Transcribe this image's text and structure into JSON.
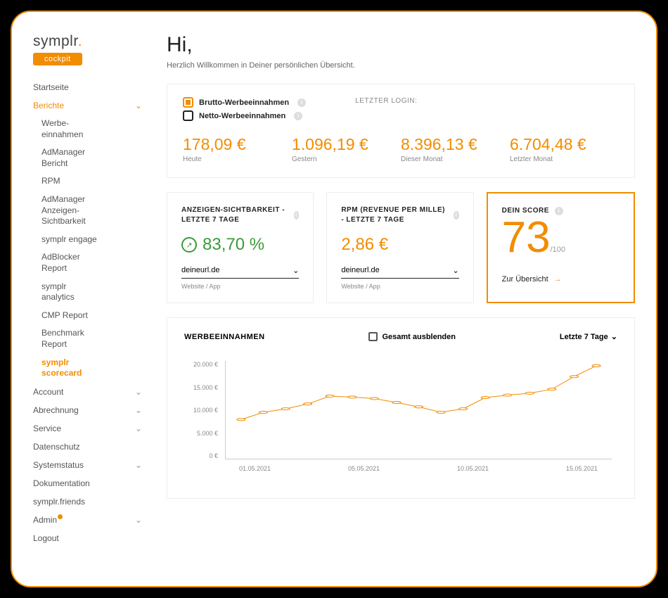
{
  "brand": {
    "name": "symplr",
    "badge": "cockpit"
  },
  "nav": {
    "startseite": "Startseite",
    "berichte": "Berichte",
    "sub": {
      "werbe": "Werbe-\neinnahmen",
      "admanager": "AdManager\nBericht",
      "rpm": "RPM",
      "anzeigen": "AdManager\nAnzeigen-\nSichtbarkeit",
      "engage": "symplr engage",
      "adblocker": "AdBlocker\nReport",
      "analytics": "symplr\nanalytics",
      "cmp": "CMP Report",
      "benchmark": "Benchmark\nReport",
      "scorecard": "symplr\nscorecard"
    },
    "account": "Account",
    "abrechnung": "Abrechnung",
    "service": "Service",
    "datenschutz": "Datenschutz",
    "systemstatus": "Systemstatus",
    "dokumentation": "Dokumentation",
    "friends": "symplr.friends",
    "admin": "Admin",
    "logout": "Logout"
  },
  "header": {
    "greeting": "Hi,",
    "sub": "Herzlich Willkommen in Deiner persönlichen Übersicht."
  },
  "top": {
    "brutto": "Brutto-Werbeeinnahmen",
    "netto": "Netto-Werbeeinnahmen",
    "login": "LETZTER LOGIN:",
    "stats": [
      {
        "val": "178,09 €",
        "lbl": "Heute"
      },
      {
        "val": "1.096,19 €",
        "lbl": "Gestern"
      },
      {
        "val": "8.396,13 €",
        "lbl": "Dieser Monat"
      },
      {
        "val": "6.704,48 €",
        "lbl": "Letzter Monat"
      }
    ]
  },
  "cards": {
    "sicht": {
      "title": "ANZEIGEN-SICHTBARKEIT - LETZTE 7 TAGE",
      "val": "83,70 %",
      "select": "deineurl.de",
      "sub": "Website / App"
    },
    "rpm": {
      "title": "RPM (REVENUE PER MILLE) - LETZTE 7 TAGE",
      "val": "2,86 €",
      "select": "deineurl.de",
      "sub": "Website / App"
    },
    "score": {
      "title": "DEIN SCORE",
      "val": "73",
      "max": "/100",
      "link": "Zur Übersicht"
    }
  },
  "chart": {
    "title": "WERBEEINNAHMEN",
    "toggle": "Gesamt ausblenden",
    "period": "Letzte 7 Tage"
  },
  "chart_data": {
    "type": "line",
    "title": "WERBEEINNAHMEN",
    "ylabel": "€",
    "ylim": [
      0,
      20000
    ],
    "y_ticks": [
      "20.000 €",
      "15.000 €",
      "10.000 €",
      "5.000 €",
      "0 €"
    ],
    "x_ticks": [
      "01.05.2021",
      "05.05.2021",
      "10.05.2021",
      "15.05.2021"
    ],
    "series": [
      {
        "name": "Gesamt",
        "color": "#f28c00",
        "values": [
          8000,
          9500,
          10200,
          11200,
          12800,
          12600,
          12300,
          11500,
          10600,
          9500,
          10200,
          12500,
          13000,
          13400,
          14200,
          16800,
          19000
        ]
      }
    ]
  }
}
